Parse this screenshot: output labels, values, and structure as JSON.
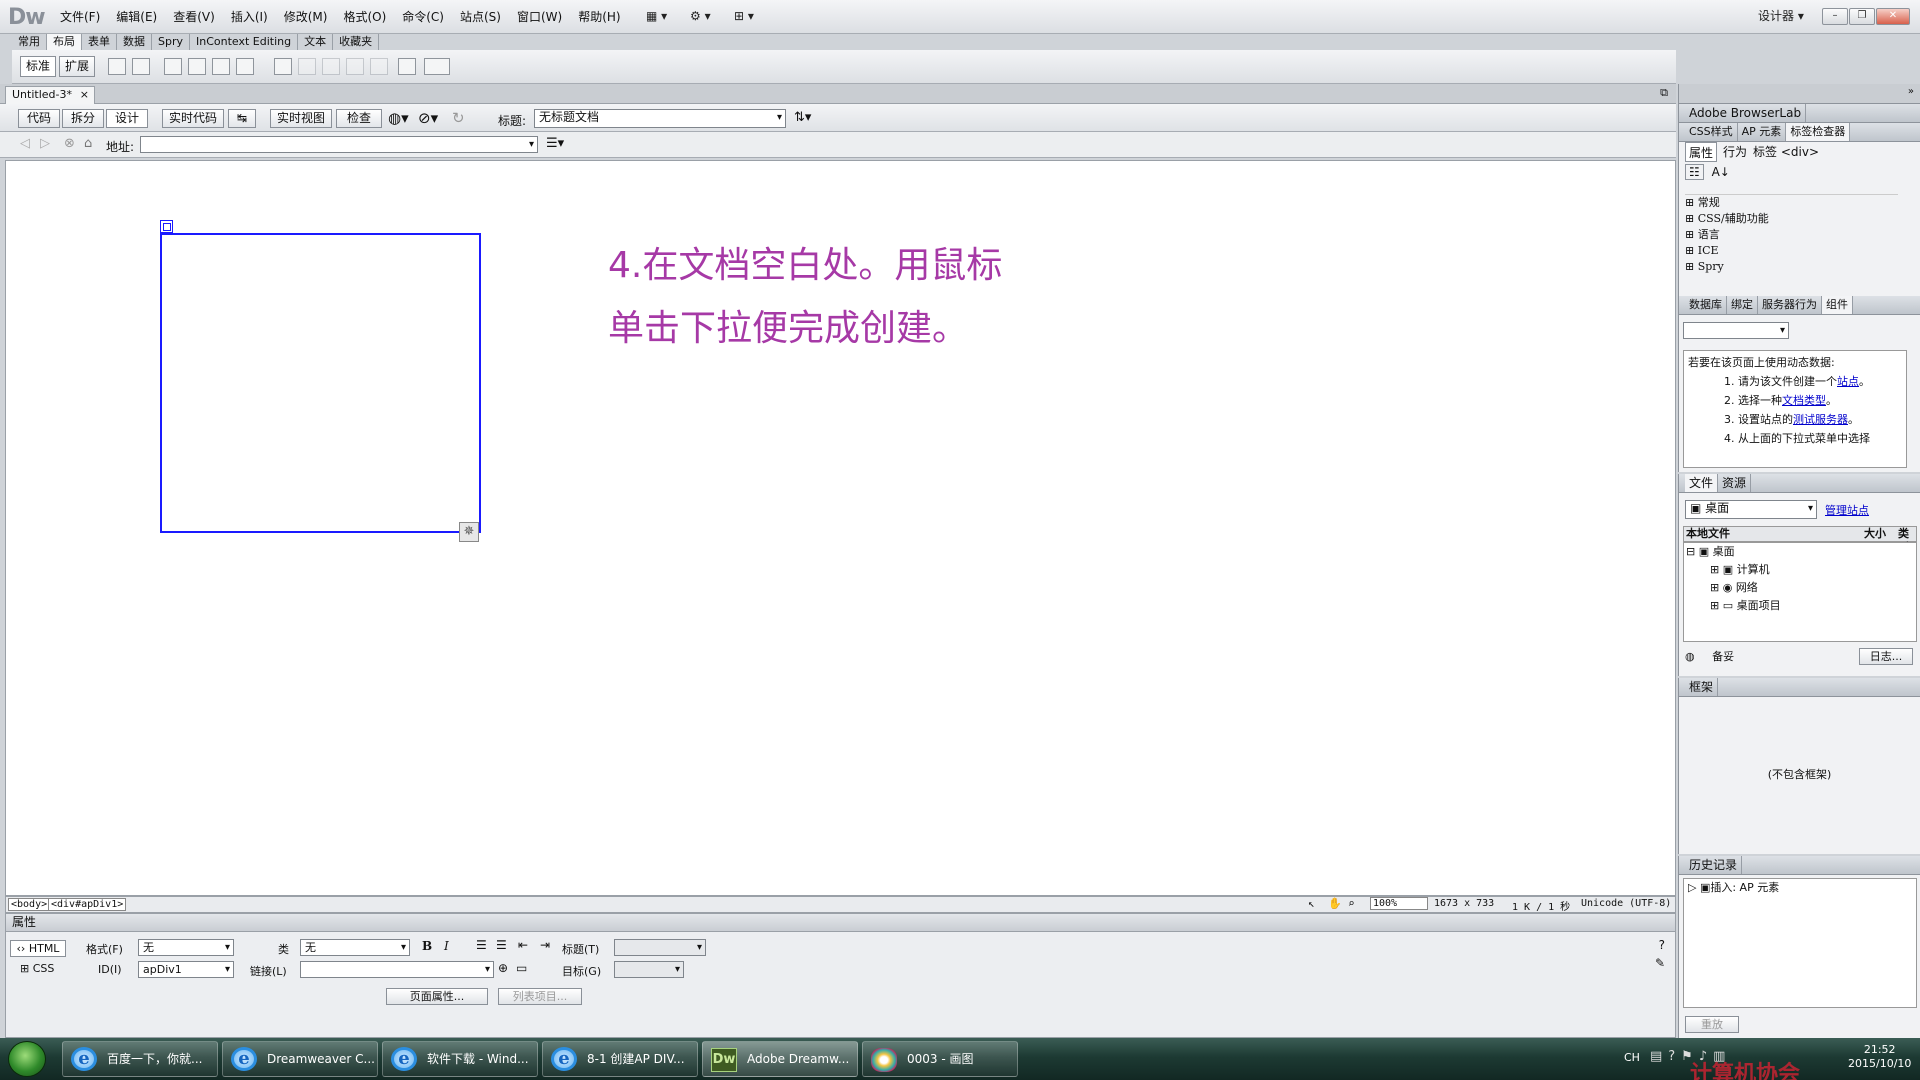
{
  "app": {
    "logo": "Dw"
  },
  "menubar": {
    "items": [
      "文件(F)",
      "编辑(E)",
      "查看(V)",
      "插入(I)",
      "修改(M)",
      "格式(O)",
      "命令(C)",
      "站点(S)",
      "窗口(W)",
      "帮助(H)"
    ],
    "workspace": "设计器"
  },
  "insert_tabs": [
    "常用",
    "布局",
    "表单",
    "数据",
    "Spry",
    "InContext Editing",
    "文本",
    "收藏夹"
  ],
  "insert_mode": {
    "standard": "标准",
    "expanded": "扩展"
  },
  "document": {
    "tab_title": "Untitled-3*"
  },
  "viewbar": {
    "code": "代码",
    "split": "拆分",
    "design": "设计",
    "live_code": "实时代码",
    "live_view": "实时视图",
    "inspect": "检查",
    "title_label": "标题:",
    "title_value": "无标题文档"
  },
  "addressbar": {
    "label": "地址:",
    "value": ""
  },
  "canvas": {
    "note_line1": "4.在文档空白处。用鼠标",
    "note_line2": "单击下拉便完成创建。"
  },
  "statusbar": {
    "tags": [
      "<body>",
      "<div#apDiv1>"
    ],
    "zoom": "100%",
    "size": "1673 x 733",
    "filesize": "1 K / 1 秒",
    "encoding": "Unicode (UTF-8)"
  },
  "properties": {
    "header": "属性",
    "html": "HTML",
    "css": "CSS",
    "format_label": "格式(F)",
    "format_value": "无",
    "id_label": "ID(I)",
    "id_value": "apDiv1",
    "class_label": "类",
    "class_value": "无",
    "link_label": "链接(L)",
    "title_label": "标题(T)",
    "target_label": "目标(G)",
    "page_props": "页面属性...",
    "list_item": "列表项目..."
  },
  "panels": {
    "browserlab": "Adobe BrowserLab",
    "tag_tabs": [
      "CSS样式",
      "AP 元素",
      "标签检查器"
    ],
    "tag_subtabs": [
      "属性",
      "行为"
    ],
    "tag_label": "标签 <div>",
    "tag_categories": [
      "常规",
      "CSS/辅助功能",
      "语言",
      "ICE",
      "Spry"
    ],
    "db_tabs": [
      "数据库",
      "绑定",
      "服务器行为",
      "组件"
    ],
    "db_intro": "若要在该页面上使用动态数据:",
    "db_steps": [
      {
        "pre": "1. 请为该文件创建一个",
        "link": "站点",
        "post": "。"
      },
      {
        "pre": "2. 选择一种",
        "link": "文档类型",
        "post": "。"
      },
      {
        "pre": "3. 设置站点的",
        "link": "测试服务器",
        "post": "。"
      },
      {
        "pre": "4. 从上面的下拉式菜单中选择",
        "link": "",
        "post": ""
      }
    ],
    "files_tabs": [
      "文件",
      "资源"
    ],
    "files_location": "桌面",
    "manage_sites": "管理站点",
    "files_header": {
      "name": "本地文件",
      "size": "大小",
      "type": "类型"
    },
    "files_tree": [
      "桌面",
      "计算机",
      "网络",
      "桌面项目"
    ],
    "files_footer_ready": "备妥",
    "files_log": "日志...",
    "frames_title": "框架",
    "frames_empty": "(不包含框架)",
    "history_title": "历史记录",
    "history_item": "插入: AP 元素",
    "replay": "重放"
  },
  "taskbar": {
    "items": [
      "百度一下，你就...",
      "Dreamweaver C...",
      "软件下载 - Wind...",
      "8-1 创建AP DIV...",
      "Adobe Dreamw...",
      "0003 - 画图"
    ],
    "lang": "CH",
    "time": "21:52",
    "date": "2015/10/10",
    "watermark": "计算机协会"
  }
}
